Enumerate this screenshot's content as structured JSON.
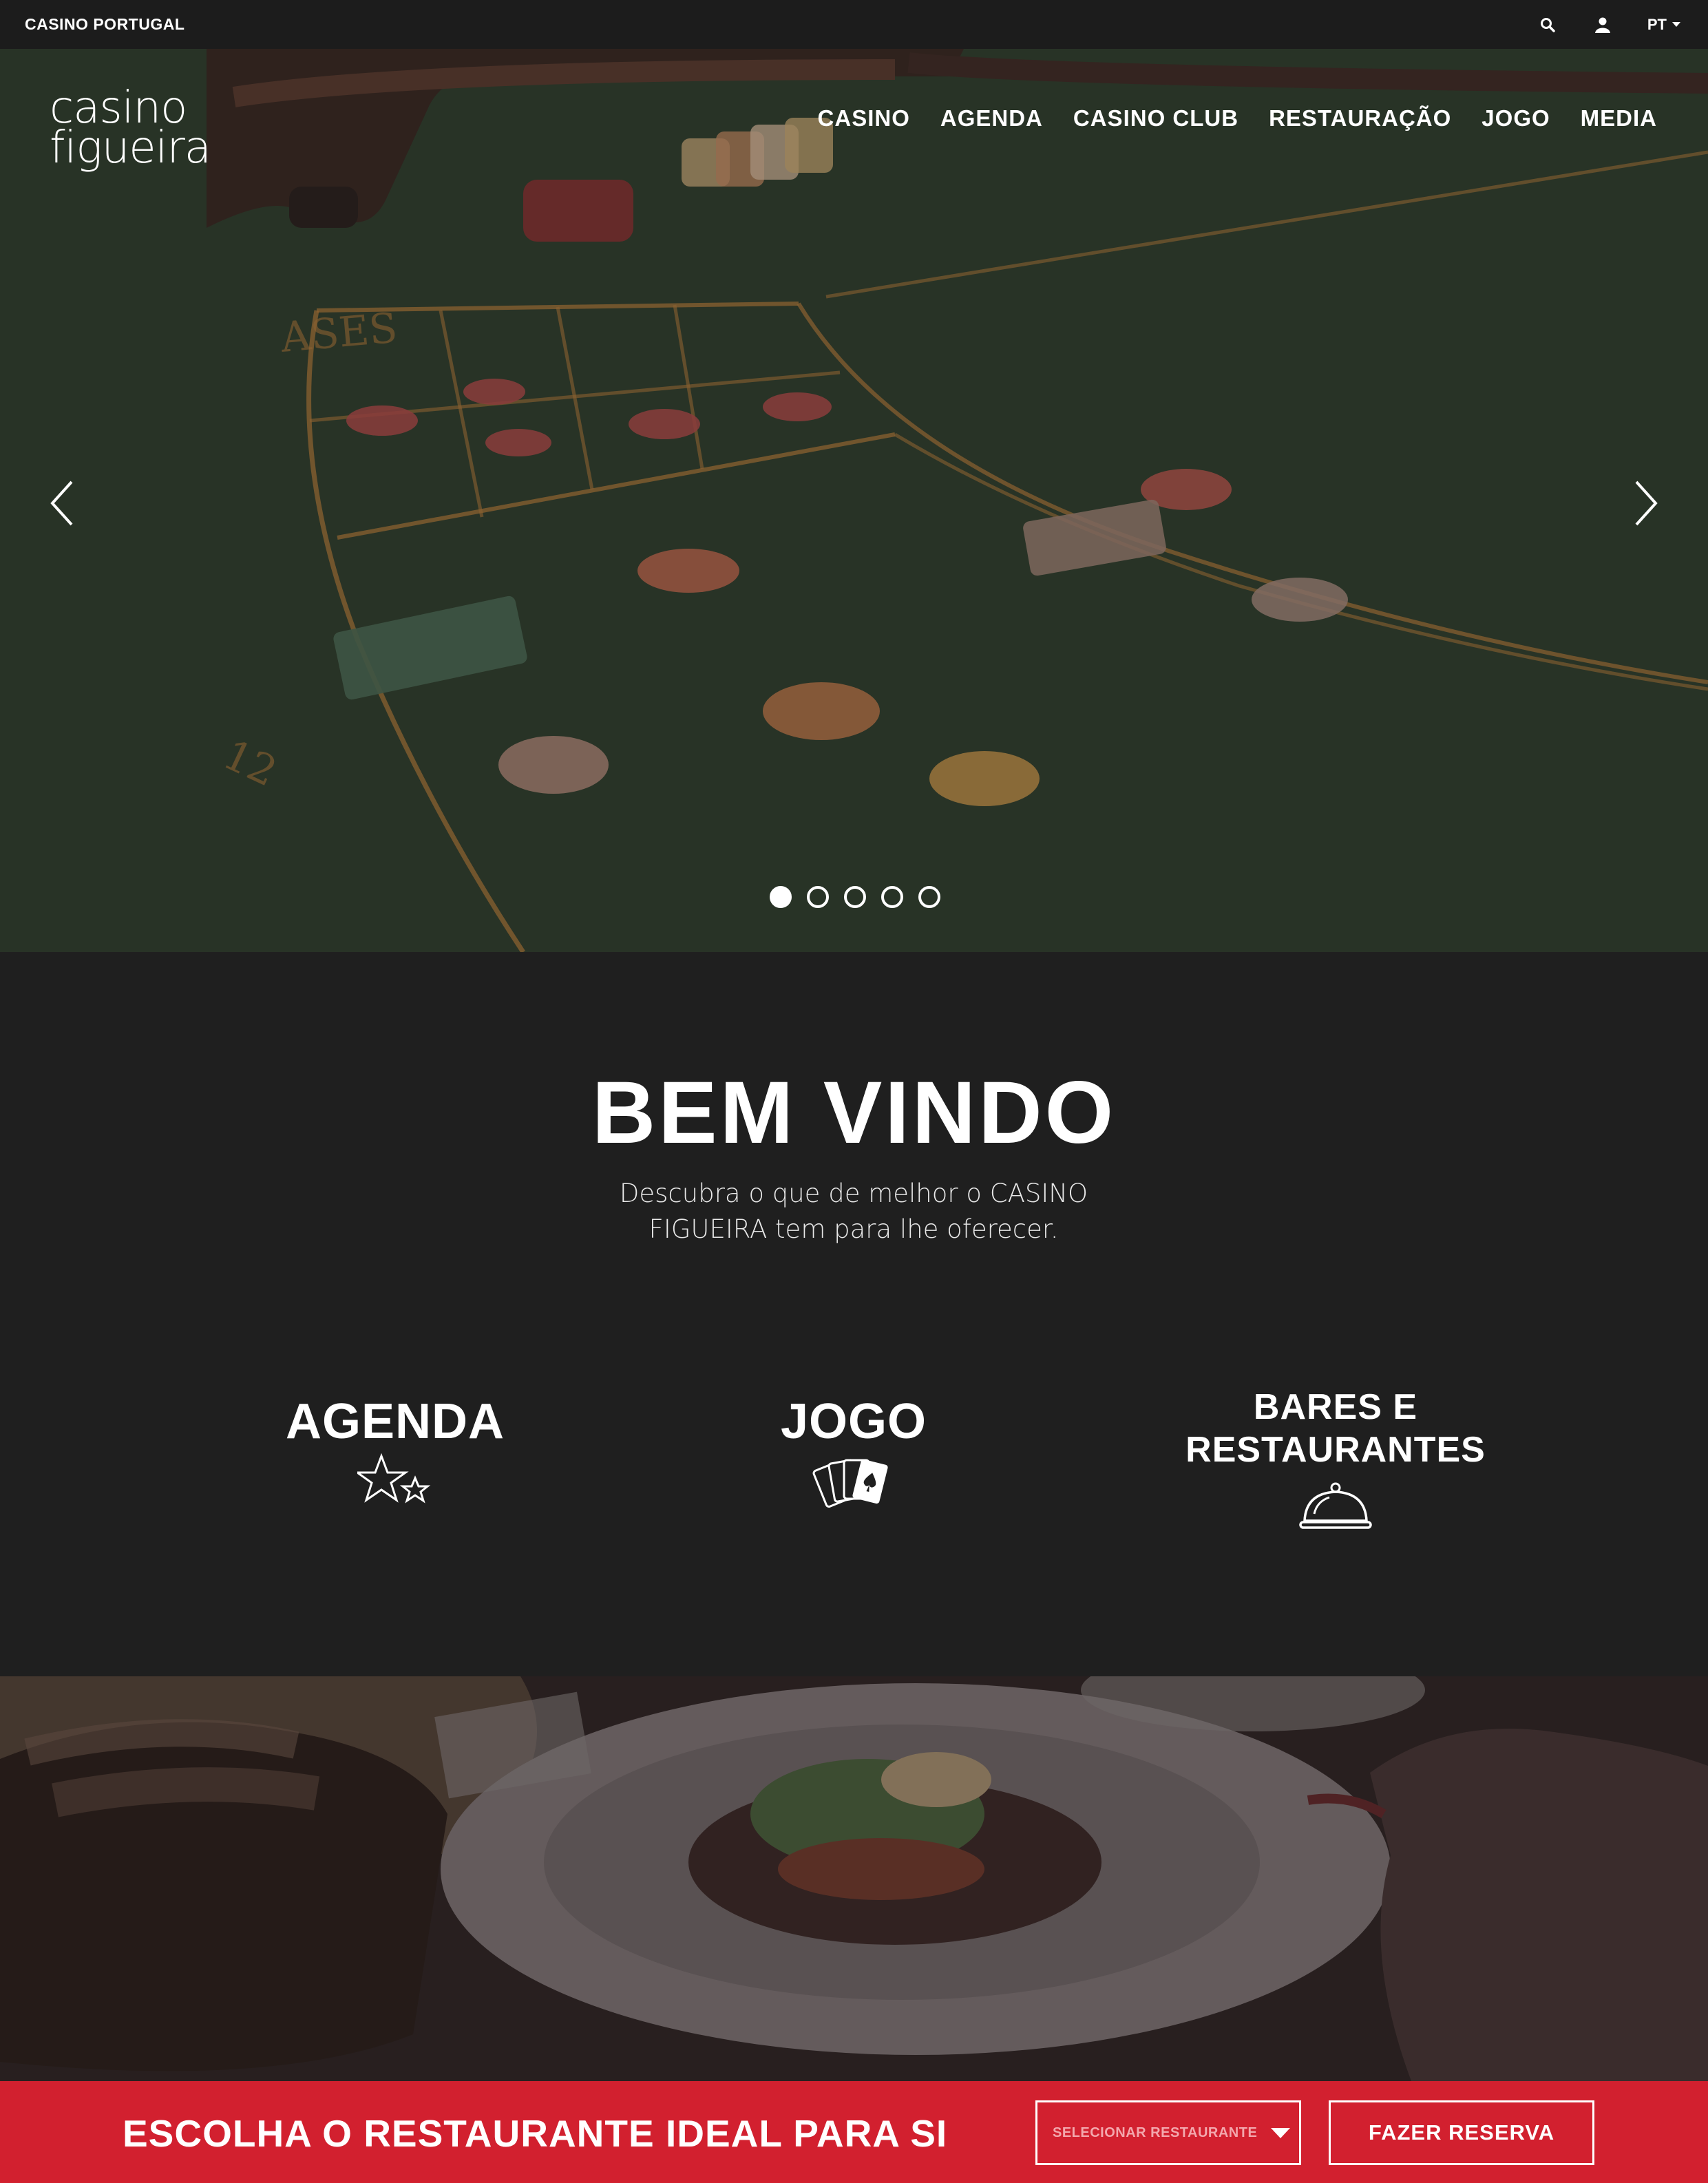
{
  "topbar": {
    "brand": "CASINO PORTUGAL",
    "language": "PT",
    "icons": [
      "search-icon",
      "user-icon"
    ]
  },
  "header": {
    "logo_line1": "casino",
    "logo_line2": "figueira",
    "nav": [
      {
        "label": "CASINO"
      },
      {
        "label": "AGENDA"
      },
      {
        "label": "CASINO CLUB"
      },
      {
        "label": "RESTAURAÇÃO"
      },
      {
        "label": "JOGO"
      },
      {
        "label": "MEDIA"
      }
    ]
  },
  "slider": {
    "total_slides": 5,
    "active_slide": 1
  },
  "welcome": {
    "title": "BEM VINDO",
    "subtitle": "Descubra o que de melhor o CASINO FIGUEIRA tem para lhe oferecer."
  },
  "features": [
    {
      "title": "AGENDA",
      "icon": "stars-icon"
    },
    {
      "title": "JOGO",
      "icon": "playing-cards-icon"
    },
    {
      "title_line1": "BARES E",
      "title_line2": "RESTAURANTES",
      "icon": "cloche-icon"
    }
  ],
  "reservation": {
    "title": "ESCOLHA O RESTAURANTE IDEAL PARA SI",
    "select_placeholder": "SELECIONAR RESTAURANTE",
    "button": "FAZER RESERVA"
  },
  "colors": {
    "accent": "#d2202f",
    "dark_bg": "#1f1f1f",
    "topbar_bg": "#1c1c1c"
  }
}
